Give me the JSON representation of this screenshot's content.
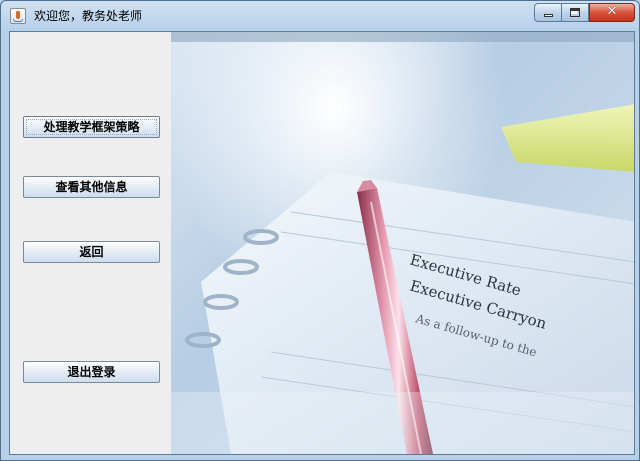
{
  "window": {
    "title": "欢迎您，教务处老师",
    "close_label": "✕"
  },
  "sidebar": {
    "buttons": [
      {
        "label": "处理教学框架策略"
      },
      {
        "label": "查看其他信息"
      },
      {
        "label": "返回"
      },
      {
        "label": "退出登录"
      }
    ]
  },
  "background_image": {
    "paper_lines": [
      "Executive Rate",
      "Executive Carryon",
      "As a follow-up to the"
    ]
  },
  "colors": {
    "titlebar": "#b7d0ea",
    "panel": "#eeeeee",
    "close_button": "#c0351f",
    "pen_pink": "#c9637a",
    "highlighter_yellow": "#e5f07a"
  }
}
